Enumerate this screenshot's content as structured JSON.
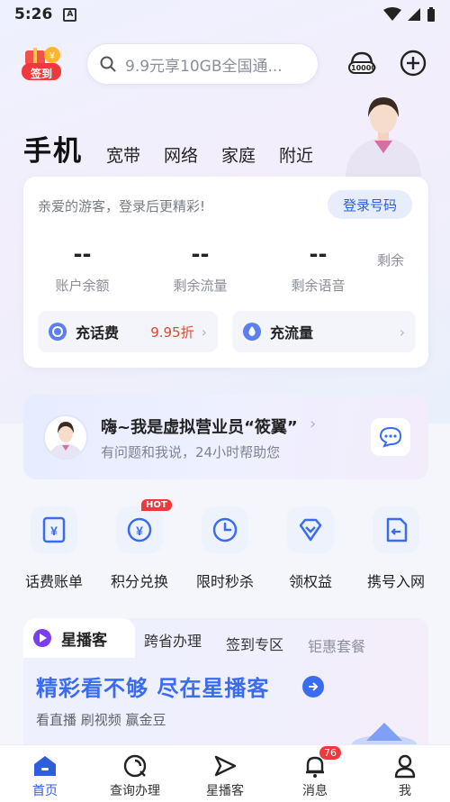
{
  "status_bar": {
    "time": "5:26",
    "notif_glyph": "A"
  },
  "header": {
    "sign_in_label": "签到",
    "search_placeholder": "9.9元享10GB全国通...",
    "hotline_label": "10000"
  },
  "tabs": {
    "main": "手机",
    "items": [
      "宽带",
      "网络",
      "家庭",
      "附近"
    ]
  },
  "account": {
    "greeting": "亲爱的游客，登录后更精彩!",
    "login_label": "登录号码",
    "stats": [
      {
        "value": "--",
        "label": "账户余额"
      },
      {
        "value": "--",
        "label": "剩余流量"
      },
      {
        "value": "--",
        "label": "剩余语音"
      },
      {
        "value": "",
        "label": "剩余"
      }
    ],
    "recharge": {
      "label": "充话费",
      "promo": "9.95折"
    },
    "data_recharge": {
      "label": "充流量"
    }
  },
  "assistant": {
    "title": "嗨~我是虚拟营业员“筱翼”",
    "subtitle": "有问题和我说，24小时帮助您"
  },
  "services": [
    {
      "label": "话费账单",
      "icon": "bill-icon"
    },
    {
      "label": "积分兑换",
      "icon": "points-exchange-icon",
      "badge": "HOT"
    },
    {
      "label": "限时秒杀",
      "icon": "clock-icon"
    },
    {
      "label": "领权益",
      "icon": "diamond-icon"
    },
    {
      "label": "携号入网",
      "icon": "sim-card-icon"
    }
  ],
  "content_tabs": {
    "active": "星播客",
    "items": [
      "跨省办理",
      "签到专区",
      "钜惠套餐"
    ],
    "slogan": "精彩看不够 尽在星播客",
    "sub": "看直播 刷视频 赢金豆"
  },
  "bottom_nav": {
    "items": [
      {
        "label": "首页",
        "icon": "home-icon"
      },
      {
        "label": "查询办理",
        "icon": "query-icon"
      },
      {
        "label": "星播客",
        "icon": "play-send-icon"
      },
      {
        "label": "消息",
        "icon": "bell-icon",
        "badge": "76"
      },
      {
        "label": "我",
        "icon": "person-icon"
      }
    ]
  },
  "colors": {
    "accent": "#2f5de0",
    "promo": "#e8452c",
    "badge": "#f0393c"
  }
}
